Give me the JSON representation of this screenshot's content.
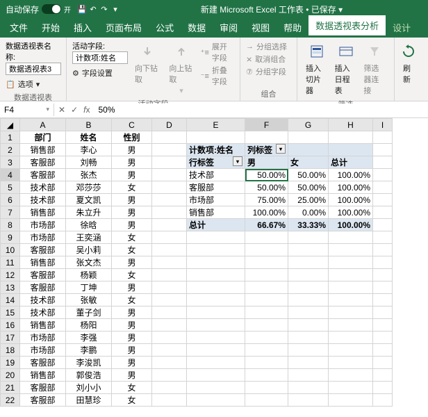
{
  "titlebar": {
    "autosave_label": "自动保存",
    "autosave_state": "开",
    "title": "新建 Microsoft Excel 工作表 • 已保存 ▾"
  },
  "tabs": {
    "file": "文件",
    "home": "开始",
    "insert": "插入",
    "pagelayout": "页面布局",
    "formulas": "公式",
    "data": "数据",
    "review": "审阅",
    "view": "视图",
    "help": "帮助",
    "pivot_analyze": "数据透视表分析",
    "design": "设计"
  },
  "ribbon": {
    "pt_name_label": "数据透视表名称:",
    "pt_name_value": "数据透视表3",
    "options_btn": "选项",
    "group1_label": "数据透视表",
    "active_field_label": "活动字段:",
    "active_field_value": "计数项:姓名",
    "field_settings": "字段设置",
    "drill_down": "向下钻取",
    "drill_up": "向上钻取",
    "expand_field": "展开字段",
    "collapse_field": "折叠字段",
    "group2_label": "活动字段",
    "group_selection": "分组选择",
    "ungroup": "取消组合",
    "group_field": "分组字段",
    "group3_label": "组合",
    "insert_slicer": "插入切片器",
    "insert_timeline": "插入日程表",
    "filter_conn": "筛选器连接",
    "group4_label": "筛选",
    "refresh": "刷新"
  },
  "formula_bar": {
    "name_box": "F4",
    "formula": "50%"
  },
  "columns": [
    "A",
    "B",
    "C",
    "D",
    "E",
    "F",
    "G",
    "H",
    "I"
  ],
  "left_data": {
    "headers": {
      "dept": "部门",
      "name": "姓名",
      "gender": "性别"
    },
    "rows": [
      {
        "dept": "销售部",
        "name": "李心",
        "gender": "男"
      },
      {
        "dept": "客服部",
        "name": "刘畅",
        "gender": "男"
      },
      {
        "dept": "客服部",
        "name": "张杰",
        "gender": "男"
      },
      {
        "dept": "技术部",
        "name": "邓莎莎",
        "gender": "女"
      },
      {
        "dept": "技术部",
        "name": "夏文凯",
        "gender": "男"
      },
      {
        "dept": "销售部",
        "name": "朱立升",
        "gender": "男"
      },
      {
        "dept": "市场部",
        "name": "徐晗",
        "gender": "男"
      },
      {
        "dept": "市场部",
        "name": "王奕涵",
        "gender": "女"
      },
      {
        "dept": "客服部",
        "name": "吴小莉",
        "gender": "女"
      },
      {
        "dept": "销售部",
        "name": "张文杰",
        "gender": "男"
      },
      {
        "dept": "客服部",
        "name": "杨颖",
        "gender": "女"
      },
      {
        "dept": "客服部",
        "name": "丁坤",
        "gender": "男"
      },
      {
        "dept": "技术部",
        "name": "张敏",
        "gender": "女"
      },
      {
        "dept": "技术部",
        "name": "董子剑",
        "gender": "男"
      },
      {
        "dept": "销售部",
        "name": "杨阳",
        "gender": "男"
      },
      {
        "dept": "市场部",
        "name": "李强",
        "gender": "男"
      },
      {
        "dept": "市场部",
        "name": "李鹏",
        "gender": "男"
      },
      {
        "dept": "客服部",
        "name": "李浚凯",
        "gender": "男"
      },
      {
        "dept": "销售部",
        "name": "郭俊浩",
        "gender": "男"
      },
      {
        "dept": "客服部",
        "name": "刘小小",
        "gender": "女"
      },
      {
        "dept": "客服部",
        "name": "田慧珍",
        "gender": "女"
      }
    ]
  },
  "pivot": {
    "count_label": "计数项:姓名",
    "col_label": "列标签",
    "row_label": "行标签",
    "male": "男",
    "female": "女",
    "total": "总计",
    "rows": [
      {
        "label": "技术部",
        "m": "50.00%",
        "f": "50.00%",
        "t": "100.00%"
      },
      {
        "label": "客服部",
        "m": "50.00%",
        "f": "50.00%",
        "t": "100.00%"
      },
      {
        "label": "市场部",
        "m": "75.00%",
        "f": "25.00%",
        "t": "100.00%"
      },
      {
        "label": "销售部",
        "m": "100.00%",
        "f": "0.00%",
        "t": "100.00%"
      }
    ],
    "grand": {
      "label": "总计",
      "m": "66.67%",
      "f": "33.33%",
      "t": "100.00%"
    }
  }
}
